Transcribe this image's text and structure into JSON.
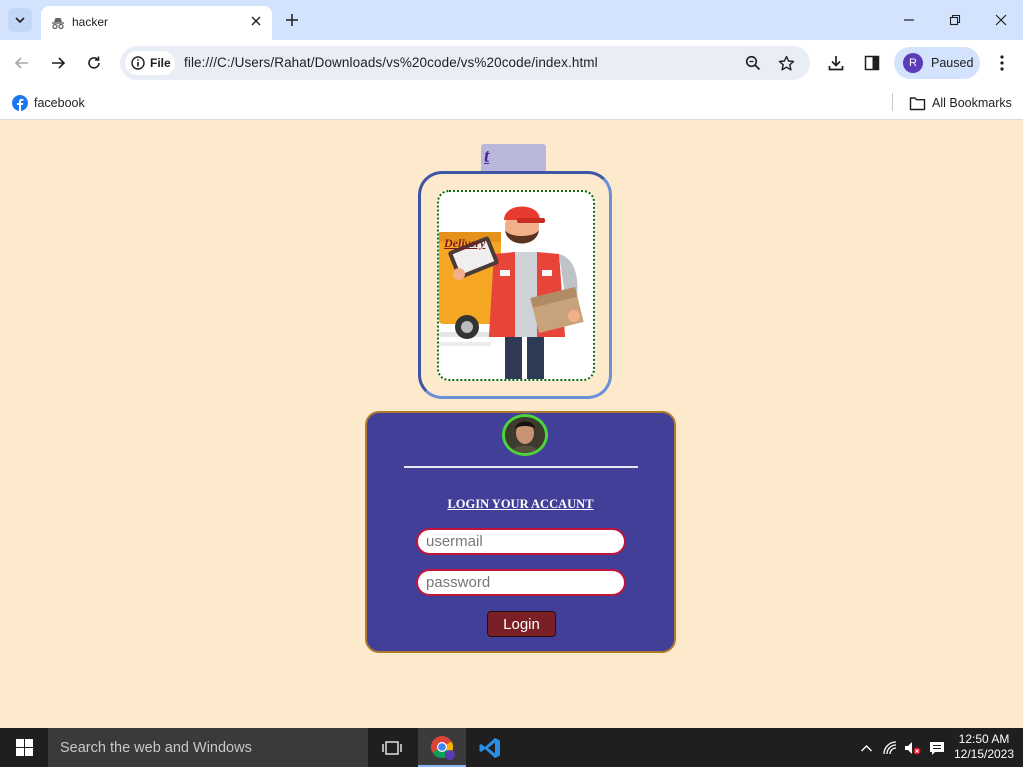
{
  "browser": {
    "tab_title": "hacker",
    "site_chip_label": "File",
    "url": "file:///C:/Users/Rahat/Downloads/vs%20code/vs%20code/index.html",
    "profile_initial": "R",
    "profile_status": "Paused",
    "bookmarks": [
      {
        "label": "facebook",
        "icon": "facebook-icon"
      }
    ],
    "all_bookmarks_label": "All Bookmarks"
  },
  "page": {
    "top_link": "t",
    "image_caption": "Delivery",
    "login": {
      "heading": "LOGIN YOUR ACCAUNT",
      "email_placeholder": "usermail",
      "password_placeholder": "password",
      "button_label": "Login"
    }
  },
  "taskbar": {
    "search_placeholder": "Search the web and Windows",
    "time": "12:50 AM",
    "date": "12/15/2023"
  },
  "colors": {
    "page_background": "#fde9cb",
    "card_background": "#423f99",
    "button_background": "#7a1f25",
    "field_border": "#c0143c",
    "avatar_ring": "#4ed43a"
  }
}
